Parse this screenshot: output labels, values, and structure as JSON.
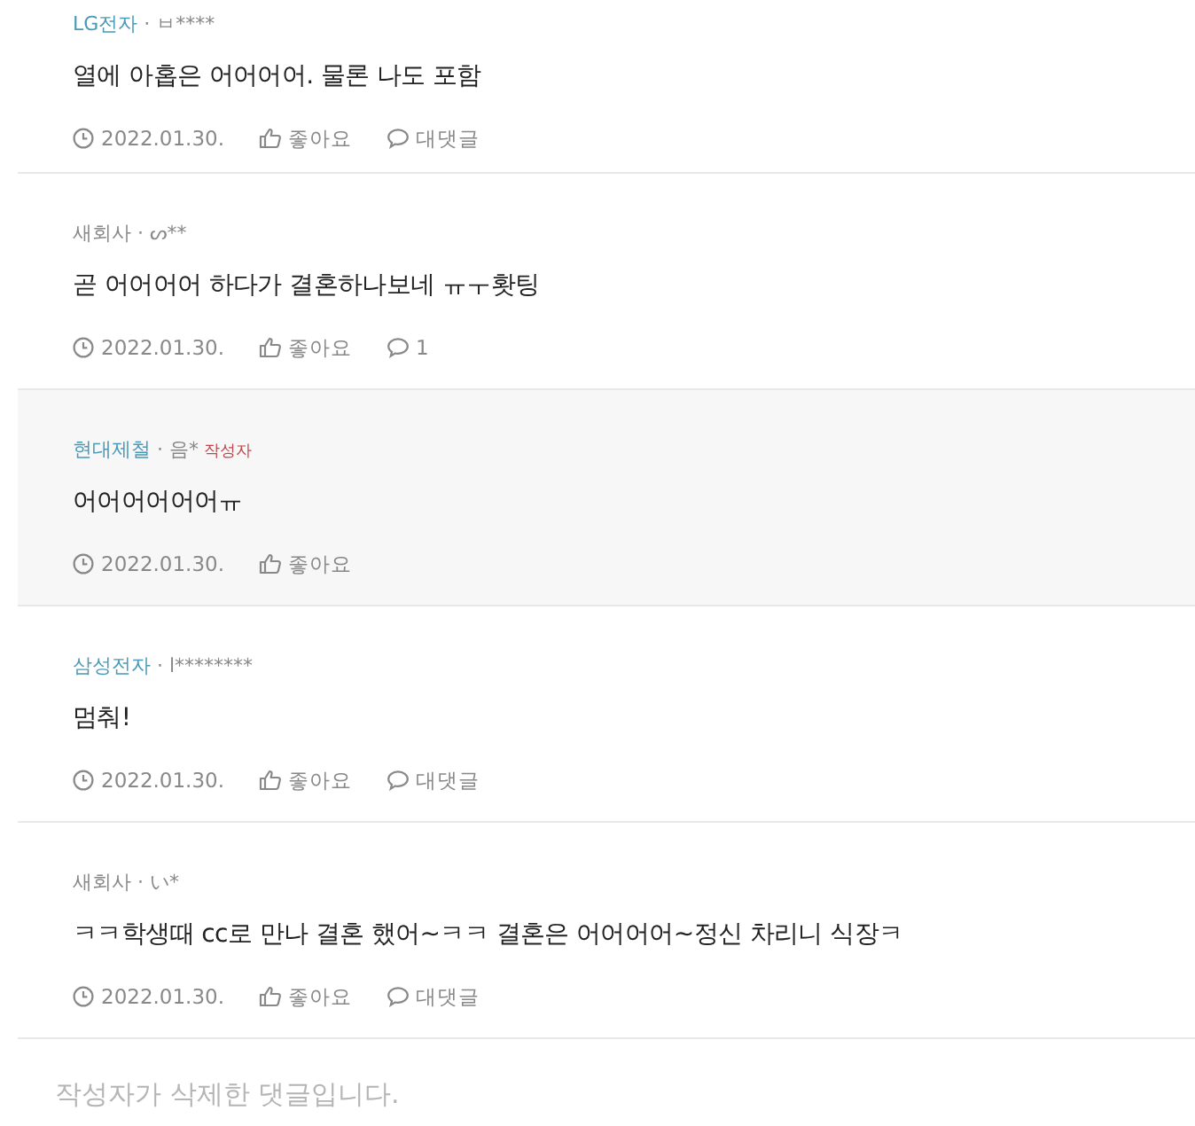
{
  "comments": [
    {
      "kind": "comment",
      "company": "LG전자",
      "color": "#4a9bb8",
      "user": "· ㅂ****",
      "text": "열에 아홉은 어어어어. 물론 나도 포함",
      "date": "2022.01.30.",
      "like": "좋아요",
      "reply": "대댓글"
    },
    {
      "kind": "comment",
      "company": "새회사",
      "color": "#888888",
      "user": "· ᔕ**",
      "text": "곧 어어어어 하다가 결혼하나보네 ㅠㅜ홧팅",
      "date": "2022.01.30.",
      "like": "좋아요",
      "reply": "1"
    },
    {
      "kind": "reply",
      "company": "현대제철",
      "color": "#4a9bb8",
      "user": "· 음*",
      "author_tag": "작성자",
      "text": "어어어어어어ㅠ",
      "date": "2022.01.30.",
      "like": "좋아요"
    },
    {
      "kind": "comment",
      "company": "삼성전자",
      "color": "#4a9bb8",
      "user": "· l********",
      "text": "멈춰!",
      "date": "2022.01.30.",
      "like": "좋아요",
      "reply": "대댓글"
    },
    {
      "kind": "comment",
      "company": "새회사",
      "color": "#888888",
      "user": "· い*",
      "text": "ㅋㅋ학생때 cc로 만나 결혼 했어~ㅋㅋ 결혼은 어어어어~정신 차리니 식장ㅋ",
      "date": "2022.01.30.",
      "like": "좋아요",
      "reply": "대댓글"
    },
    {
      "kind": "deleted",
      "text": "작성자가 삭제한 댓글입니다."
    }
  ]
}
